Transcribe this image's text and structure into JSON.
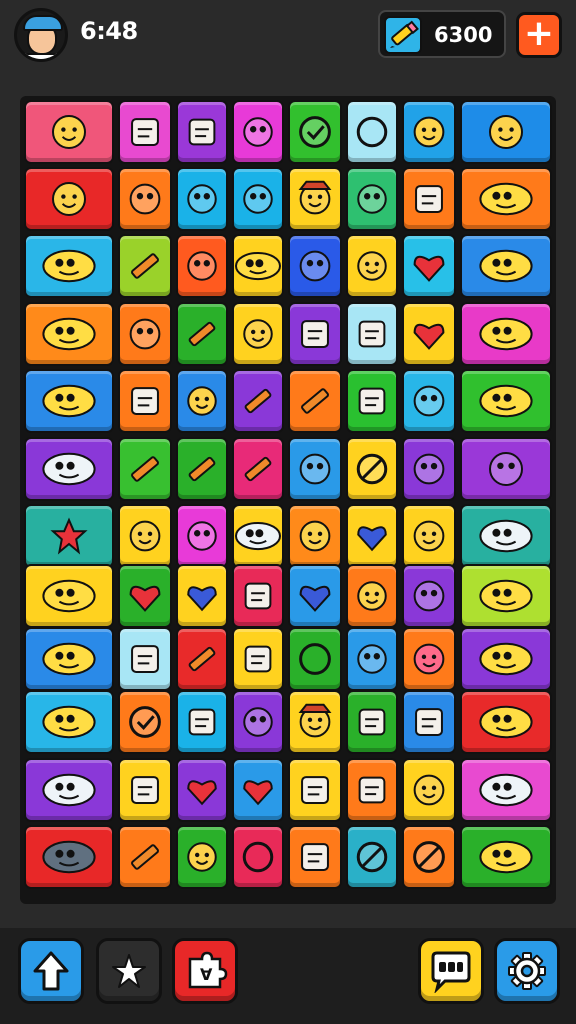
{
  "status": {
    "time": "6:48",
    "coins": "6300"
  },
  "top_actions": {
    "plus_icon": "plus-icon",
    "pencil_icon": "pencil-icon",
    "avatar_icon": "player-avatar"
  },
  "bottom_buttons": [
    {
      "name": "upgrade-button",
      "icon": "arrow-up-icon",
      "color": "#2a9be8"
    },
    {
      "name": "star-button",
      "icon": "star-icon",
      "color": "#2d2d2d"
    },
    {
      "name": "shuffle-button",
      "icon": "puzzle-icon",
      "color": "#e82828"
    },
    {
      "name": "chat-button",
      "icon": "chat-icon",
      "color": "#ffd21f"
    },
    {
      "name": "settings-button",
      "icon": "gear-icon",
      "color": "#2a9be8"
    }
  ],
  "board": {
    "rows": [
      [
        "#f0567a",
        "#e84ad0",
        "#9a38d8",
        "#e83ad8",
        "#32c02e",
        "#a8e6f5",
        "#21a2e8",
        "#1e8ce8"
      ],
      [
        "#e82828",
        "#ff7a1a",
        "#1ab2e8",
        "#1ab2e8",
        "#ffd21f",
        "#2ec070",
        "#ff7a1a",
        "#ff7a1a"
      ],
      [
        "#2ab6e8",
        "#9ad22a",
        "#ff5a1f",
        "#ffd21f",
        "#2a5ae8",
        "#ffd21f",
        "#28c0e8",
        "#2a8ae8"
      ],
      [
        "#ff8a1a",
        "#ff7a1a",
        "#2ab02a",
        "#ffd21f",
        "#8a38d8",
        "#a8e6f5",
        "#ffd21f",
        "#e83ac8"
      ],
      [
        "#2a8ae8",
        "#ff7a1a",
        "#2a8ae8",
        "#8a38d8",
        "#ff7a1a",
        "#2ac030",
        "#28b6e8",
        "#30c02e"
      ],
      [
        "#8a38d8",
        "#38c030",
        "#2ab02a",
        "#e82a78",
        "#2a9ae8",
        "#ffd21f",
        "#8a38d8",
        "#9a38d8"
      ],
      [
        "#28b0a0",
        "#ffd21f",
        "#e83ad8",
        "#ffd21f",
        "#ff8a1a",
        "#ffd21f",
        "#ffd21f",
        "#28b0a0"
      ],
      [
        "#ffd21f",
        "#2ab02a",
        "#ffd21f",
        "#e82a58",
        "#2a9ae8",
        "#ff7a1a",
        "#8a38d8",
        "#aee030"
      ],
      [
        "#2a8ae8",
        "#a8e6f5",
        "#e82a2a",
        "#ffd21f",
        "#2ab02a",
        "#2a9ae8",
        "#ff7a1a",
        "#8a38d8"
      ],
      [
        "#28b6e8",
        "#ff7a1a",
        "#1ab2e8",
        "#8a38d8",
        "#ffd21f",
        "#2ab02a",
        "#2a8ae8",
        "#e82a2a"
      ],
      [
        "#8a38d8",
        "#ffd21f",
        "#8a38d8",
        "#2a9ae8",
        "#ffd21f",
        "#ff7a1a",
        "#ffd21f",
        "#e84ad0"
      ],
      [
        "#e82828",
        "#ff7a1a",
        "#2ab02a",
        "#e82a58",
        "#ff7a1a",
        "#2ab0c8",
        "#ff7a1a",
        "#2ab02a"
      ]
    ],
    "icons": [
      [
        "boy-face-icon",
        "cupcake-icon",
        "eraser-icon",
        "chick-icon",
        "check-badge-icon",
        "donut-icon",
        "smiley-icon",
        "grin-face-icon"
      ],
      [
        "cat-face-icon",
        "frog-hat-icon",
        "sun-icon",
        "leaf-icon",
        "cowboy-icon",
        "ghost-icon",
        "notepad-icon",
        "fish-icon"
      ],
      [
        "fish-icon",
        "pencil-icon",
        "ninja-icon",
        "starfish-icon",
        "eggplant-icon",
        "cat-face-icon",
        "strawberry-icon",
        "blob-icon"
      ],
      [
        "fish-icon",
        "egg-icon",
        "pencil-icon",
        "boy-face-icon",
        "robot-icon",
        "gift-icon",
        "heart-icon",
        "pig-icon"
      ],
      [
        "fish-icon",
        "jar-icon",
        "bear-face-icon",
        "pencil-icon",
        "pencil-icon",
        "cup-icon",
        "leaf-icon",
        "fish-icon"
      ],
      [
        "bus-icon",
        "pencil-icon",
        "pencil-icon",
        "pencil-icon",
        "owl-icon",
        "no-sign-icon",
        "frog-icon",
        "banana-icon"
      ],
      [
        "star-splat-icon",
        "smiley-icon",
        "candy-icon",
        "bus-icon",
        "smiley-icon",
        "shield-icon",
        "cat-face-icon",
        "bus-icon"
      ],
      [
        "fish-icon",
        "heart-icon",
        "shield-icon",
        "eraser-icon",
        "shield-icon",
        "peach-icon",
        "peacock-icon",
        "fish-icon"
      ],
      [
        "dog-icon",
        "cube-icon",
        "pencil-icon",
        "eraser-icon",
        "donut-icon",
        "leaf-icon",
        "monster-icon",
        "dino-icon"
      ],
      [
        "fish-icon",
        "check-badge-icon",
        "book-icon",
        "flower-icon",
        "cowboy-icon",
        "juice-icon",
        "dice-icon",
        "fish-icon"
      ],
      [
        "bus-icon",
        "dice-icon",
        "strawberry-icon",
        "apple-icon",
        "eraser-icon",
        "eraser-icon",
        "smiley-icon",
        "bus-icon"
      ],
      [
        "shark-icon",
        "pencil-icon",
        "boy-face-icon",
        "donut-icon",
        "cake-icon",
        "no-sign-icon",
        "no-sign-icon",
        "fish-icon"
      ]
    ]
  }
}
